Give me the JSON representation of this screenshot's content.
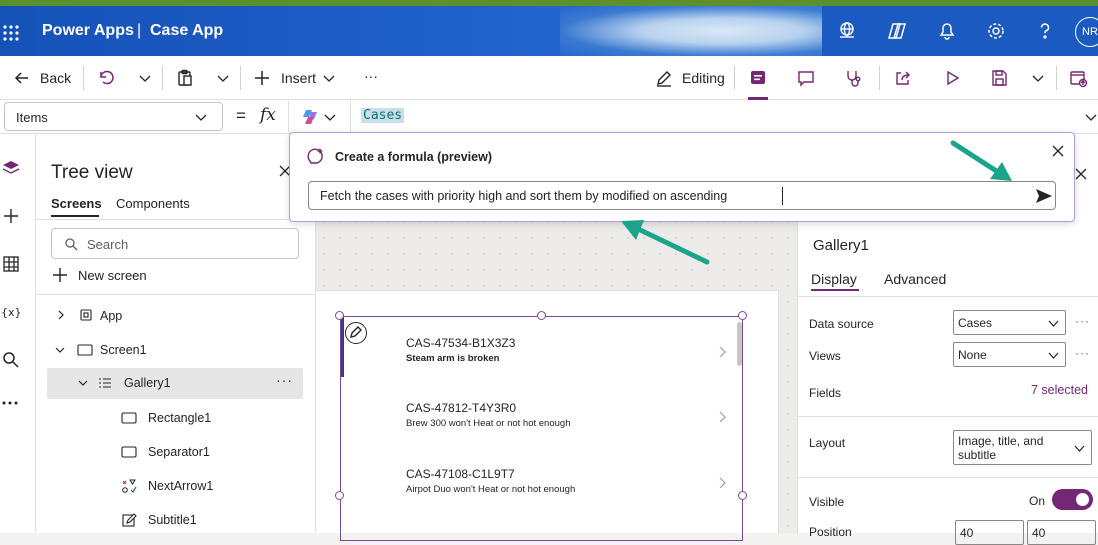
{
  "app": {
    "product": "Power Apps",
    "separator": "|",
    "app_name": "Case App",
    "user_initials": "NR"
  },
  "colors": {
    "brand_blue": "#1f5fc9",
    "accent_purple": "#742774",
    "annotation_teal": "#1aa58a"
  },
  "command_bar": {
    "back_label": "Back",
    "insert_label": "Insert",
    "more_label": "···",
    "editing_label": "Editing"
  },
  "formula_bar": {
    "property": "Items",
    "equals": "=",
    "fx": "fx",
    "formula": "Cases"
  },
  "copilot_popup": {
    "title": "Create a formula (preview)",
    "prompt": "Fetch the cases with priority high and sort them by modified on ascending"
  },
  "tree_view": {
    "title": "Tree view",
    "tabs": [
      "Screens",
      "Components"
    ],
    "search_placeholder": "Search",
    "new_screen_label": "New screen",
    "items": [
      {
        "label": "App",
        "icon": "app-icon"
      },
      {
        "label": "Screen1",
        "icon": "screen-icon"
      },
      {
        "label": "Gallery1",
        "icon": "gallery-icon",
        "selected": true
      },
      {
        "label": "Rectangle1",
        "icon": "rectangle-icon"
      },
      {
        "label": "Separator1",
        "icon": "rectangle-icon"
      },
      {
        "label": "NextArrow1",
        "icon": "icon-control-icon"
      },
      {
        "label": "Subtitle1",
        "icon": "edit-label-icon"
      }
    ]
  },
  "gallery": {
    "items": [
      {
        "title": "CAS-47534-B1X3Z3",
        "subtitle": "Steam arm is broken"
      },
      {
        "title": "CAS-47812-T4Y3R0",
        "subtitle": "Brew 300 won't Heat or not hot enough"
      },
      {
        "title": "CAS-47108-C1L9T7",
        "subtitle": "Airpot Duo won't Heat or not hot enough"
      }
    ]
  },
  "properties": {
    "control_name": "Gallery1",
    "tabs": [
      "Display",
      "Advanced"
    ],
    "data_source_label": "Data source",
    "data_source_value": "Cases",
    "views_label": "Views",
    "views_value": "None",
    "fields_label": "Fields",
    "fields_value": "7 selected",
    "layout_label": "Layout",
    "layout_value_line1": "Image, title, and",
    "layout_value_line2": "subtitle",
    "visible_label": "Visible",
    "visible_value": "On",
    "position_label": "Position",
    "position_x": "40",
    "position_y": "40"
  }
}
